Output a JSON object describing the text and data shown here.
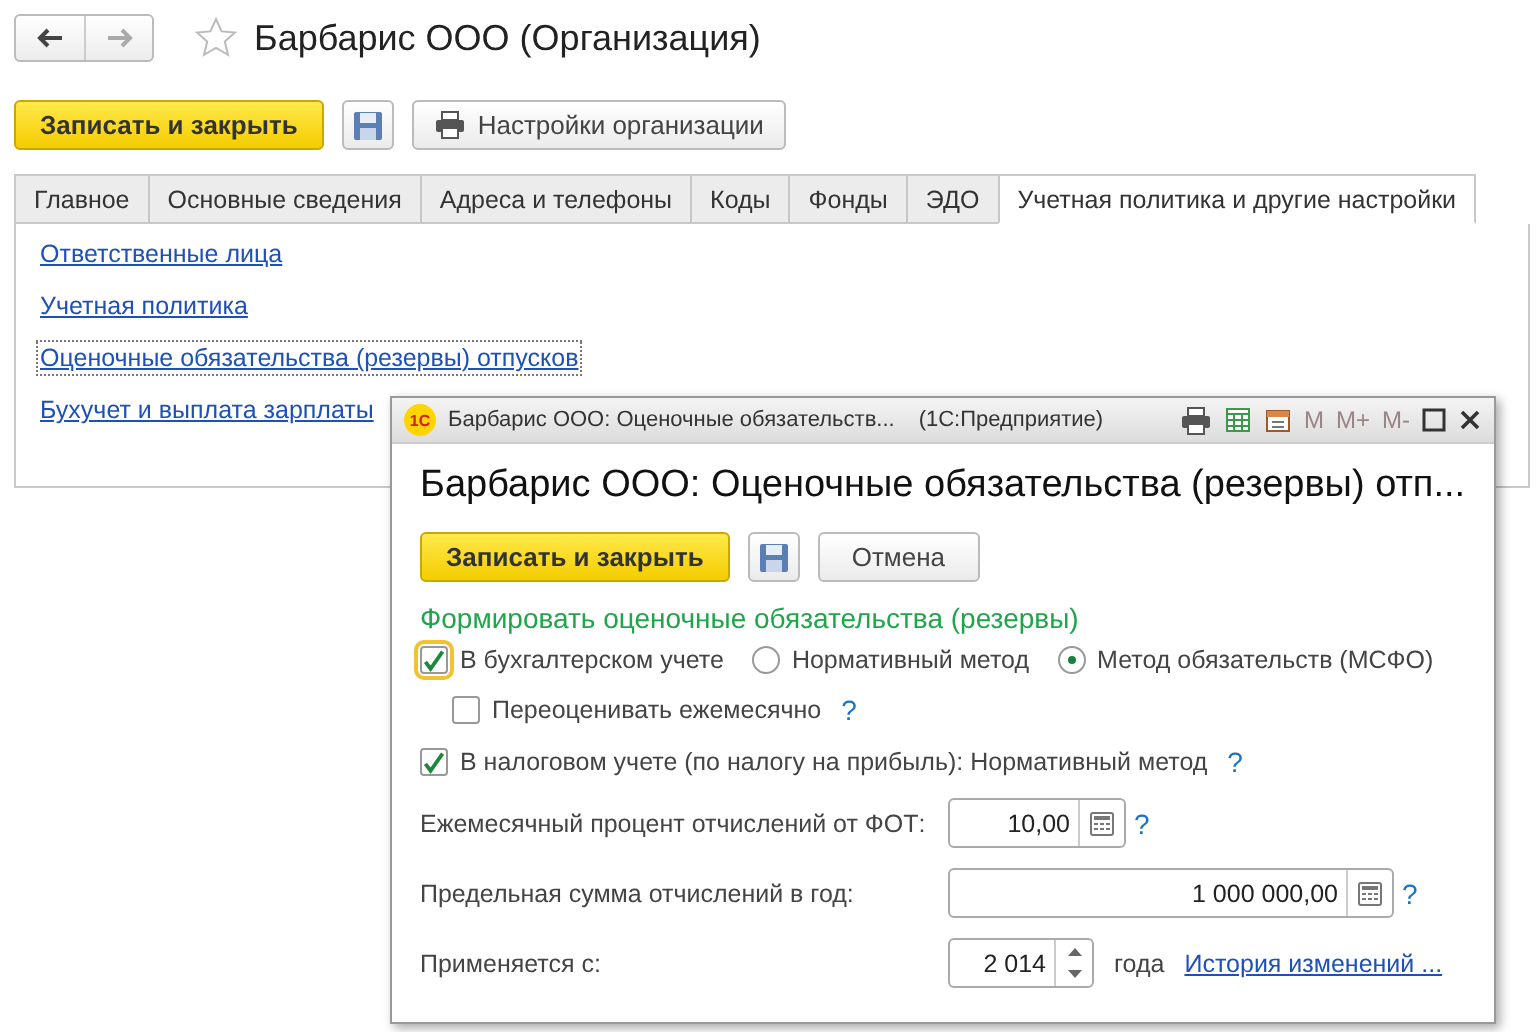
{
  "window": {
    "title": "Барбарис ООО (Организация)",
    "favorite": false
  },
  "toolbar": [
    {
      "kind": "primary",
      "label": "Записать и закрыть"
    },
    {
      "kind": "save"
    },
    {
      "kind": "print",
      "label": "Настройки организации"
    }
  ],
  "tabs": [
    {
      "label": "Главное",
      "selected": false
    },
    {
      "label": "Основные сведения",
      "selected": false
    },
    {
      "label": "Адреса и телефоны",
      "selected": false
    },
    {
      "label": "Коды",
      "selected": false
    },
    {
      "label": "Фонды",
      "selected": false
    },
    {
      "label": "ЭДО",
      "selected": false
    },
    {
      "label": "Учетная политика и другие настройки",
      "selected": true
    }
  ],
  "links": [
    {
      "label": "Ответственные лица",
      "focused": false
    },
    {
      "label": "Учетная политика",
      "focused": false
    },
    {
      "label": "Оценочные обязательства (резервы) отпусков",
      "focused": true
    },
    {
      "label": "Бухучет и выплата зарплаты",
      "focused": false
    }
  ],
  "dialog": {
    "title_bar": {
      "logo": "1С",
      "title": "Барбарис ООО: Оценочные обязательств...",
      "app": "(1С:Предприятие)",
      "memory_keys": [
        {
          "label": "M",
          "disabled": true
        },
        {
          "label": "M+",
          "disabled": true
        },
        {
          "label": "M-",
          "disabled": true
        }
      ]
    },
    "heading": "Барбарис ООО: Оценочные обязательства (резервы) отп...",
    "buttons": [
      {
        "kind": "primary",
        "label": "Записать и закрыть"
      },
      {
        "kind": "save"
      },
      {
        "kind": "plain",
        "label": "Отмена"
      }
    ],
    "section_title": "Формировать оценочные обязательства (резервы)",
    "accounting": {
      "label": "В бухгалтерском учете",
      "checked": true,
      "focused": true,
      "methods": [
        {
          "label": "Нормативный метод",
          "selected": false
        },
        {
          "label": "Метод обязательств (МСФО)",
          "selected": true
        }
      ]
    },
    "revalue": {
      "label": "Переоценивать ежемесячно",
      "checked": false,
      "help": "?"
    },
    "tax": {
      "label": "В налоговом учете (по налогу на прибыль): Нормативный метод",
      "checked": true,
      "help": "?"
    },
    "fields": [
      {
        "kind": "number",
        "label": "Ежемесячный процент отчислений от ФОТ:",
        "value": "10,00",
        "help": "?"
      },
      {
        "kind": "amount",
        "label": "Предельная сумма отчислений в год:",
        "value": "1 000 000,00",
        "help": "?"
      },
      {
        "kind": "year",
        "label": "Применяется с:",
        "value": "2 014",
        "suffix": "года",
        "link": "История изменений ..."
      }
    ]
  }
}
